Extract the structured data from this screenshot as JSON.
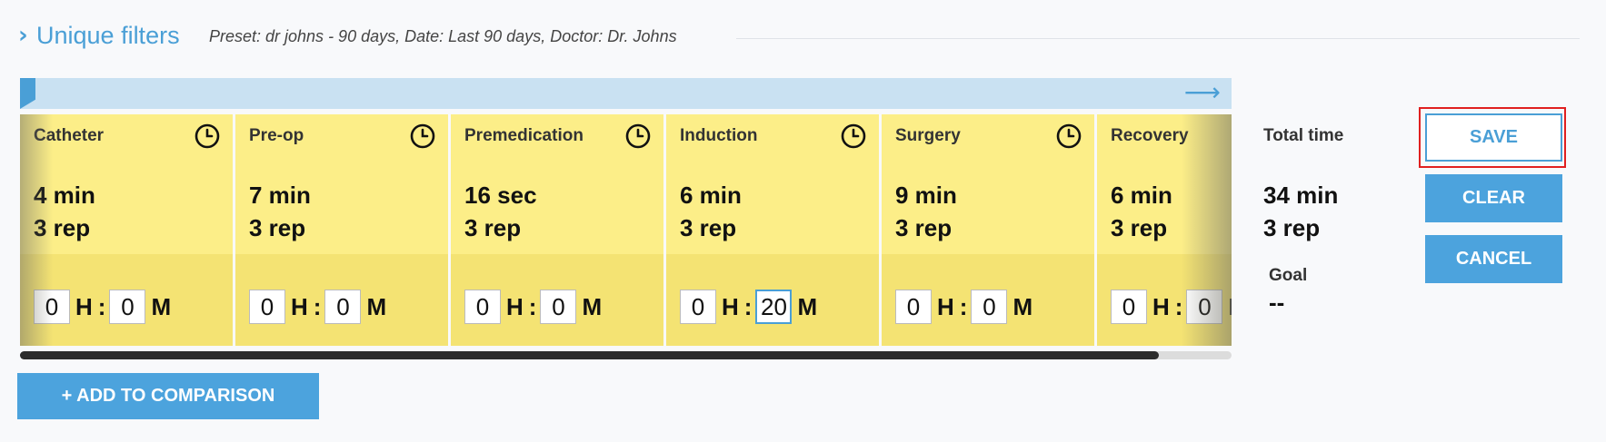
{
  "header": {
    "title": "Unique filters",
    "subtitle": "Preset: dr johns - 90 days, Date: Last 90 days, Doctor: Dr. Johns"
  },
  "stages": [
    {
      "name": "Catheter",
      "duration": "4 min",
      "reps": "3 rep",
      "hours": "0",
      "minutes": "0"
    },
    {
      "name": "Pre-op",
      "duration": "7 min",
      "reps": "3 rep",
      "hours": "0",
      "minutes": "0"
    },
    {
      "name": "Premedication",
      "duration": "16 sec",
      "reps": "3 rep",
      "hours": "0",
      "minutes": "0"
    },
    {
      "name": "Induction",
      "duration": "6 min",
      "reps": "3 rep",
      "hours": "0",
      "minutes": "20"
    },
    {
      "name": "Surgery",
      "duration": "9 min",
      "reps": "3 rep",
      "hours": "0",
      "minutes": "0"
    },
    {
      "name": "Recovery",
      "duration": "6 min",
      "reps": "3 rep",
      "hours": "0",
      "minutes": "0"
    }
  ],
  "time_units": {
    "hours": "H",
    "minutes": "M",
    "separator": ":"
  },
  "totals": {
    "label": "Total time",
    "duration": "34 min",
    "reps": "3 rep",
    "goal_label": "Goal",
    "goal_value": "--"
  },
  "buttons": {
    "save": "SAVE",
    "clear": "CLEAR",
    "cancel": "CANCEL",
    "add_comparison": "+ ADD TO COMPARISON"
  },
  "colors": {
    "accent": "#4a9fd6",
    "stage_bg": "#fcee88",
    "highlight": "#e02020"
  },
  "icons": {
    "header": "chevron-right-icon",
    "timeline": "arrow-right-icon",
    "stage": "clock-icon"
  }
}
